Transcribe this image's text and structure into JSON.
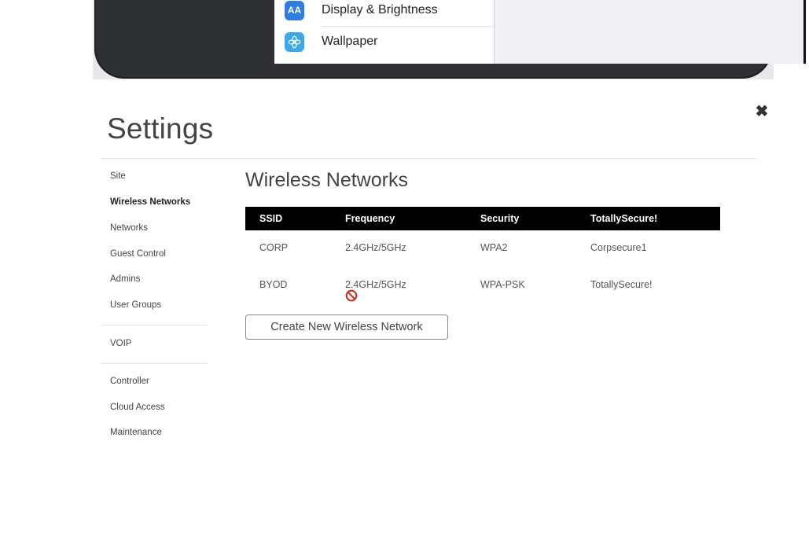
{
  "tablet": {
    "items": [
      {
        "icon_text": "AA",
        "icon": "text-size-icon",
        "label": "Display & Brightness"
      },
      {
        "icon": "flower-icon",
        "label": "Wallpaper"
      }
    ]
  },
  "header": {
    "title": "Settings",
    "close_icon": "close-icon",
    "close_glyph": "✖"
  },
  "sidebar": {
    "items": [
      {
        "label": "Site",
        "active": false
      },
      {
        "label": "Wireless Networks",
        "active": true
      },
      {
        "label": "Networks",
        "active": false
      },
      {
        "label": "Guest Control",
        "active": false
      },
      {
        "label": "Admins",
        "active": false
      },
      {
        "label": "User Groups",
        "active": false
      },
      {
        "label": "VOIP",
        "active": false
      },
      {
        "label": "Controller",
        "active": false
      },
      {
        "label": "Cloud Access",
        "active": false
      },
      {
        "label": "Maintenance",
        "active": false
      }
    ]
  },
  "main": {
    "title": "Wireless Networks",
    "table": {
      "columns": [
        "SSID",
        "Frequency",
        "Security",
        "TotallySecure!"
      ],
      "rows": [
        [
          "CORP",
          "2.4GHz/5GHz",
          "WPA2",
          "Corpsecure1"
        ],
        [
          "BYOD",
          "2.4GHz/5GHz",
          "WPA-PSK",
          "TotallySecure!"
        ]
      ]
    },
    "create_button": "Create New Wireless Network",
    "ban_icon": "no-entry-icon",
    "accent": "#c0392b"
  }
}
